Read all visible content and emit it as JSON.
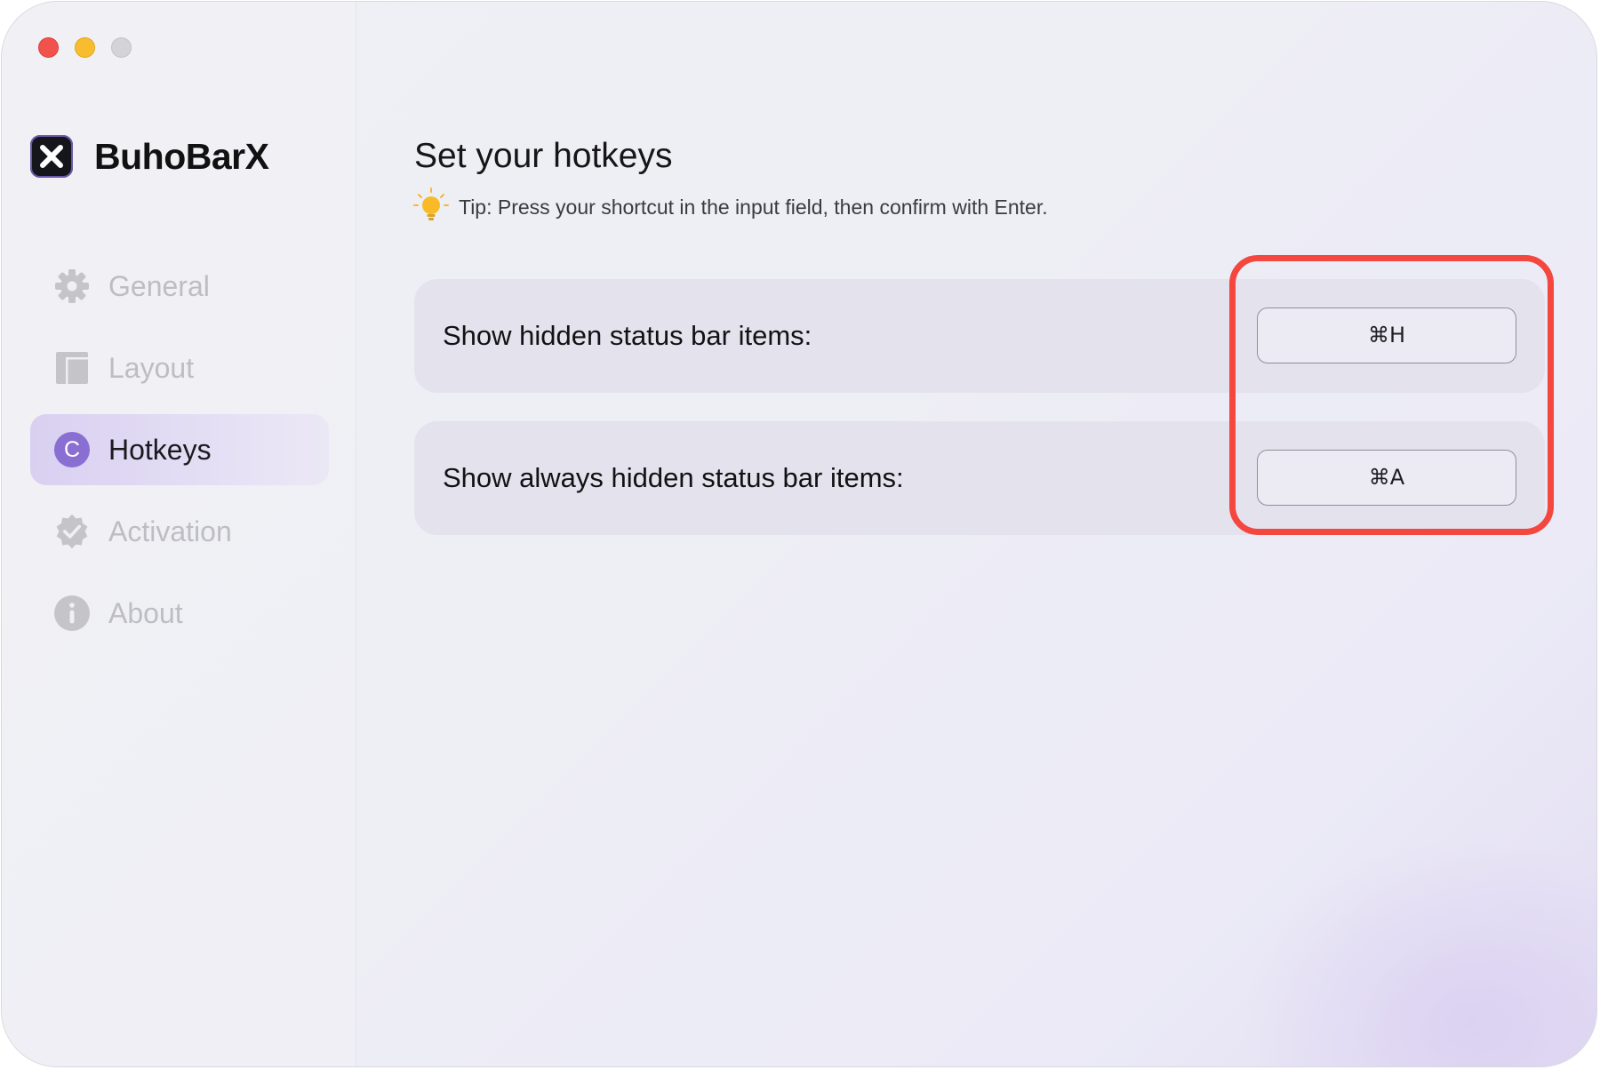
{
  "window": {
    "controls": [
      "close",
      "minimize",
      "zoom"
    ]
  },
  "brand": {
    "name": "BuhoBarX",
    "logo_icon": "x-logo-icon"
  },
  "sidebar": {
    "items": [
      {
        "label": "General",
        "icon": "gear-icon",
        "active": false
      },
      {
        "label": "Layout",
        "icon": "layout-icon",
        "active": false
      },
      {
        "label": "Hotkeys",
        "icon": "c-badge-icon",
        "badge": "C",
        "active": true
      },
      {
        "label": "Activation",
        "icon": "verified-badge-icon",
        "active": false
      },
      {
        "label": "About",
        "icon": "info-icon",
        "active": false
      }
    ]
  },
  "main": {
    "title": "Set your hotkeys",
    "tip": "Tip: Press your shortcut in the input field, then confirm with Enter.",
    "tip_icon": "lightbulb-icon",
    "hotkeys": [
      {
        "label": "Show hidden status bar items:",
        "shortcut": "⌘H"
      },
      {
        "label": "Show always hidden status bar items:",
        "shortcut": "⌘A"
      }
    ]
  },
  "colors": {
    "accent": "#8a6fd2",
    "highlight": "#f3473f",
    "row_background": "#e4e2ed"
  }
}
